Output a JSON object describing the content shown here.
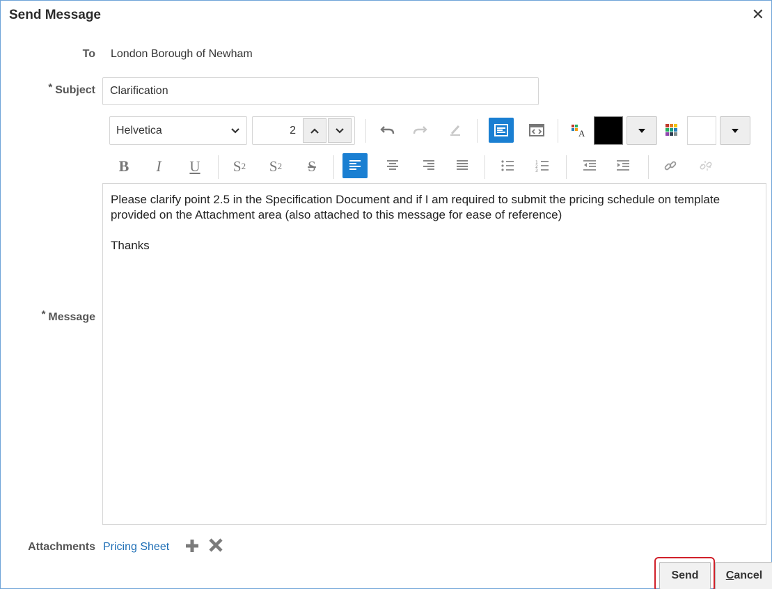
{
  "dialog": {
    "title": "Send Message",
    "close_glyph": "✕"
  },
  "to": {
    "label": "To",
    "value": "London Borough of Newham"
  },
  "subject": {
    "required_mark": "*",
    "label": "Subject",
    "value": "Clarification"
  },
  "toolbar": {
    "font_family": "Helvetica",
    "font_size": "2",
    "text_color": "#000000",
    "background_color": "#ffffff",
    "row2": {
      "bold": "B",
      "italic": "I",
      "underline": "U",
      "subscript": "S",
      "subscript_mark": "2",
      "superscript": "S",
      "superscript_mark": "2",
      "strikethrough": "S"
    }
  },
  "message": {
    "required_mark": "*",
    "label": "Message",
    "paragraphs": [
      "Please clarify point 2.5 in the Specification Document and if I am required to submit the pricing schedule on template provided on the Attachment area (also attached to this message for ease of reference)",
      "Thanks"
    ]
  },
  "attachments": {
    "label": "Attachments",
    "file": "Pricing Sheet"
  },
  "buttons": {
    "send": "Send",
    "cancel_first": "C",
    "cancel_rest": "ancel"
  },
  "colors": {
    "accent": "#1a7fd2",
    "link": "#1f6fb6",
    "highlight": "#d0202a"
  }
}
